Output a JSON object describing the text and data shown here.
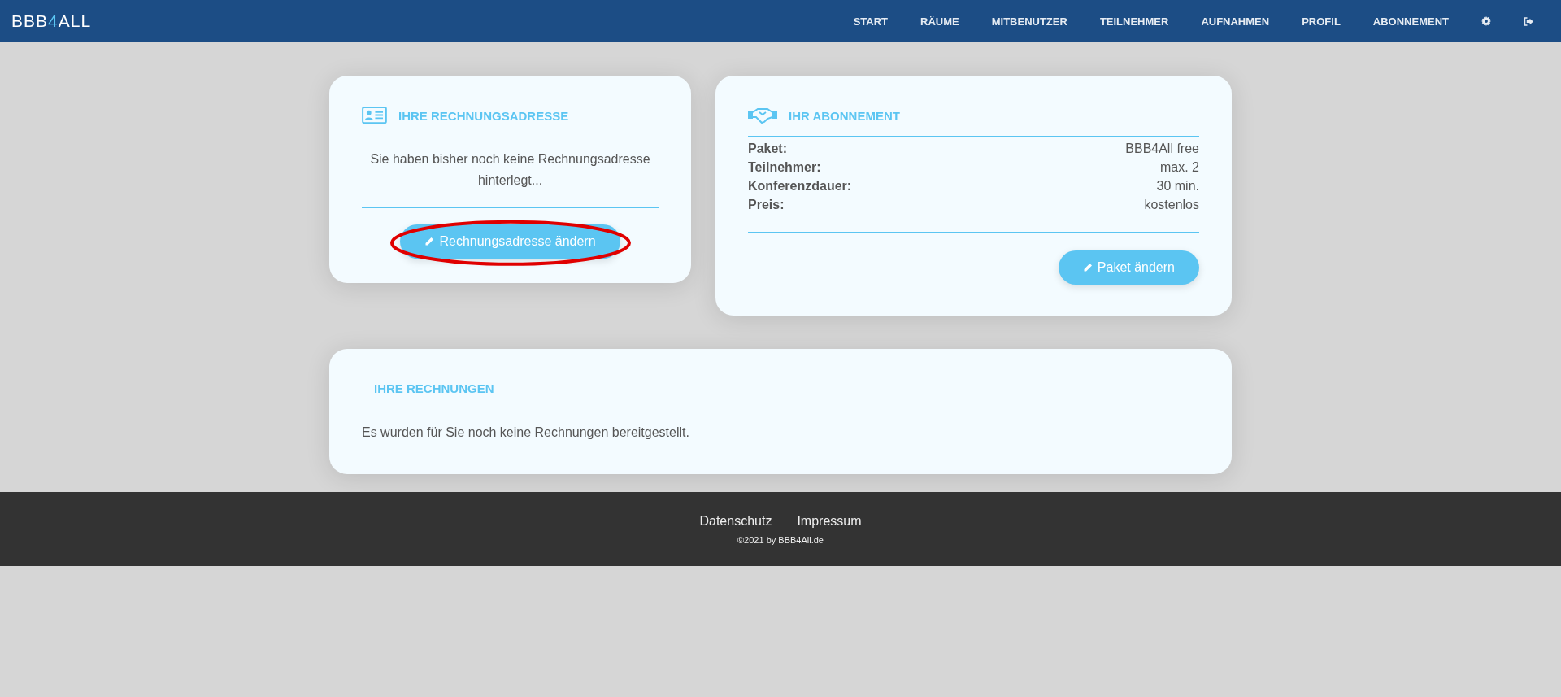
{
  "logo": {
    "before": "BBB",
    "accent": "4",
    "after": "ALL"
  },
  "nav": {
    "items": [
      {
        "label": "START",
        "selected": false
      },
      {
        "label": "RÄUME",
        "selected": false
      },
      {
        "label": "MITBENUTZER",
        "selected": false
      },
      {
        "label": "TEILNEHMER",
        "selected": false
      },
      {
        "label": "AUFNAHMEN",
        "selected": false
      },
      {
        "label": "PROFIL",
        "selected": false
      },
      {
        "label": "ABONNEMENT",
        "selected": false
      }
    ]
  },
  "billing_address": {
    "title": "IHRE RECHNUNGSADRESSE",
    "message": "Sie haben bisher noch keine Rechnungsadresse hinterlegt...",
    "button": "Rechnungsadresse ändern",
    "highlighted": true
  },
  "subscription": {
    "title": "IHR ABONNEMENT",
    "rows": [
      {
        "label": "Paket:",
        "value": "BBB4All free"
      },
      {
        "label": "Teilnehmer:",
        "value": "max. 2"
      },
      {
        "label": "Konferenzdauer:",
        "value": "30 min."
      },
      {
        "label": "Preis:",
        "value": "kostenlos"
      }
    ],
    "button": "Paket ändern"
  },
  "invoices": {
    "title": "IHRE RECHNUNGEN",
    "message": "Es wurden für Sie noch keine Rechnungen bereitgestellt."
  },
  "footer": {
    "links": [
      "Datenschutz",
      "Impressum"
    ],
    "copyright": "©2021 by BBB4All.de"
  }
}
